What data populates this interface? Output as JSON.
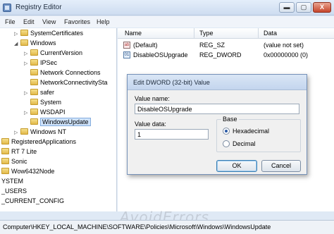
{
  "window": {
    "title": "Registry Editor",
    "controls": {
      "minimize": "▬",
      "maximize": "▢",
      "close": "X"
    }
  },
  "menu": [
    "File",
    "Edit",
    "View",
    "Favorites",
    "Help"
  ],
  "tree": {
    "items": [
      {
        "label": "SystemCertificates",
        "arrow": "▷"
      },
      {
        "label": "Windows",
        "arrow": "◢"
      },
      {
        "label": "CurrentVersion",
        "arrow": "▷"
      },
      {
        "label": "IPSec",
        "arrow": "▷"
      },
      {
        "label": "Network Connections",
        "arrow": ""
      },
      {
        "label": "NetworkConnectivitySta",
        "arrow": ""
      },
      {
        "label": "safer",
        "arrow": "▷"
      },
      {
        "label": "System",
        "arrow": ""
      },
      {
        "label": "WSDAPI",
        "arrow": "▷"
      },
      {
        "label": "WindowsUpdate",
        "arrow": ""
      },
      {
        "label": "Windows NT",
        "arrow": "▷"
      },
      {
        "label": "RegisteredApplications",
        "arrow": ""
      },
      {
        "label": "RT 7 Lite",
        "arrow": ""
      },
      {
        "label": "Sonic",
        "arrow": ""
      },
      {
        "label": "Wow6432Node",
        "arrow": ""
      },
      {
        "label": "YSTEM",
        "arrow": ""
      },
      {
        "label": "_USERS",
        "arrow": ""
      },
      {
        "label": "_CURRENT_CONFIG",
        "arrow": ""
      }
    ],
    "scroll_left": "◀",
    "scroll_right": "▶"
  },
  "values": {
    "columns": [
      "Name",
      "Type",
      "Data"
    ],
    "rows": [
      {
        "icon": "ab",
        "name": "(Default)",
        "type": "REG_SZ",
        "data": "(value not set)"
      },
      {
        "icon": "01",
        "name": "DisableOSUpgrade",
        "type": "REG_DWORD",
        "data": "0x00000000 (0)"
      }
    ]
  },
  "dialog": {
    "title": "Edit DWORD (32-bit) Value",
    "value_name_label": "Value name:",
    "value_name": "DisableOSUpgrade",
    "value_data_label": "Value data:",
    "value_data": "1",
    "base_label": "Base",
    "base_options": [
      "Hexadecimal",
      "Decimal"
    ],
    "base_selected": "Hexadecimal",
    "ok_label": "OK",
    "cancel_label": "Cancel"
  },
  "statusbar": {
    "path": "Computer\\HKEY_LOCAL_MACHINE\\SOFTWARE\\Policies\\Microsoft\\Windows\\WindowsUpdate"
  },
  "watermark": "AvoidErrors"
}
